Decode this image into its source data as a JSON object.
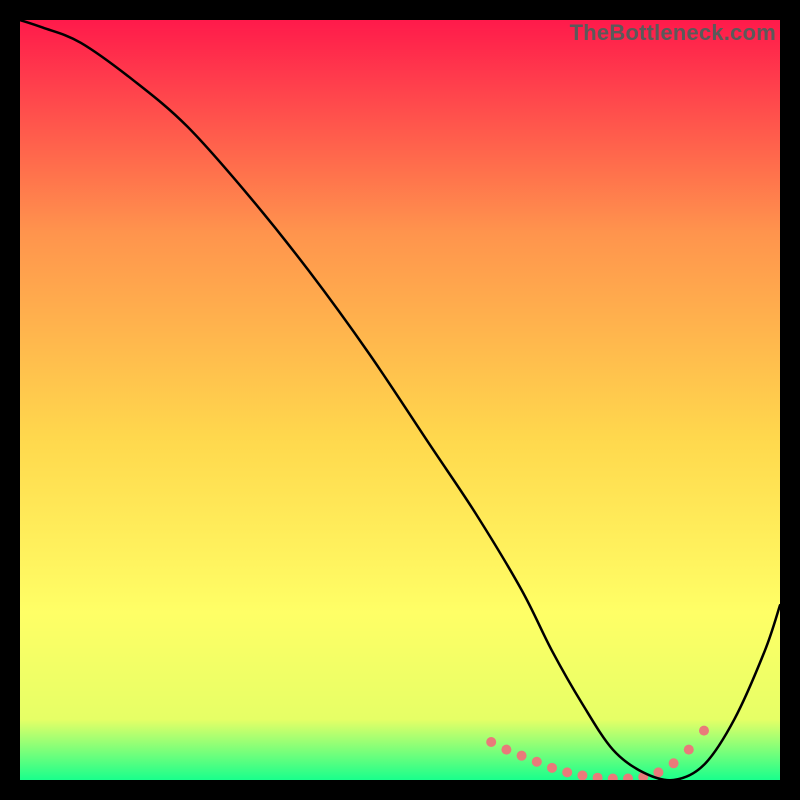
{
  "watermark": "TheBottleneck.com",
  "chart_data": {
    "type": "line",
    "title": "",
    "xlabel": "",
    "ylabel": "",
    "xlim": [
      0,
      100
    ],
    "ylim": [
      0,
      100
    ],
    "background_gradient": {
      "top": "#ff1a4b",
      "mid_upper": "#ff944d",
      "mid": "#ffd84d",
      "mid_lower": "#ffff66",
      "near_bottom": "#e6ff66",
      "bottom": "#19ff8c"
    },
    "series": [
      {
        "name": "curve",
        "x": [
          0,
          3,
          8,
          15,
          22,
          30,
          38,
          46,
          54,
          60,
          66,
          70,
          74,
          78,
          82,
          86,
          90,
          94,
          98,
          100
        ],
        "y": [
          100,
          99,
          97,
          92,
          86,
          77,
          67,
          56,
          44,
          35,
          25,
          17,
          10,
          4,
          1,
          0,
          2,
          8,
          17,
          23
        ]
      }
    ],
    "highlight_band": {
      "x": [
        62,
        64,
        66,
        68,
        70,
        72,
        74,
        76,
        78,
        80,
        82,
        84,
        86,
        88,
        90
      ],
      "y": [
        5,
        4,
        3.2,
        2.4,
        1.6,
        1.0,
        0.6,
        0.3,
        0.2,
        0.2,
        0.4,
        1.0,
        2.2,
        4.0,
        6.5
      ],
      "color": "#e97a7a",
      "dot_radius": 5
    }
  }
}
